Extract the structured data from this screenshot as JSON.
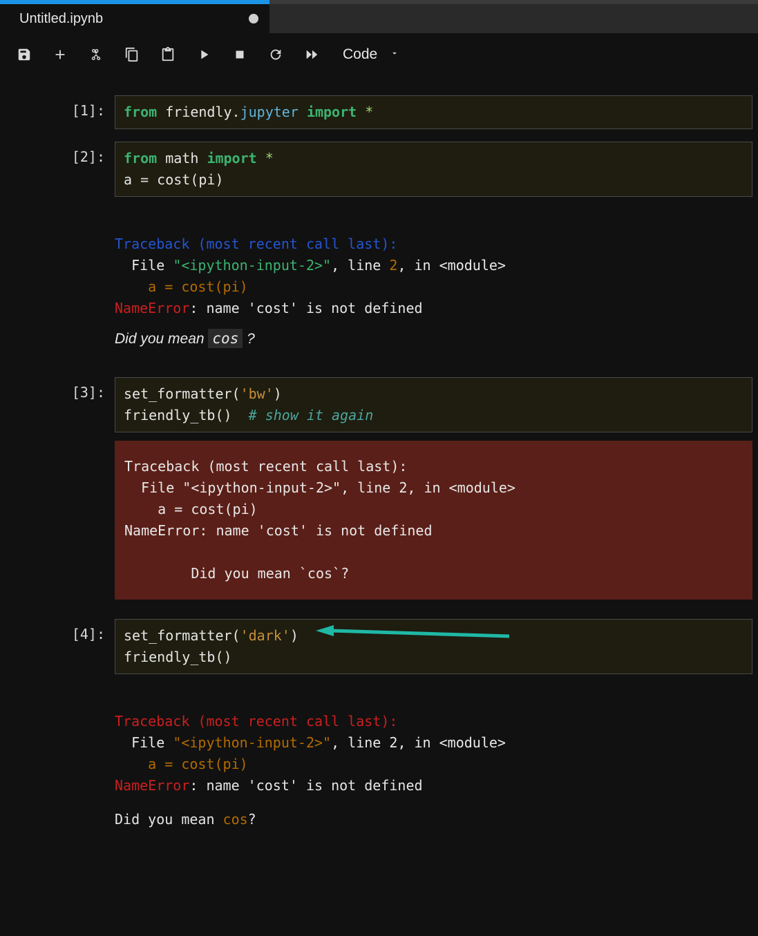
{
  "tab": {
    "title": "Untitled.ipynb"
  },
  "toolbar": {
    "celltype": "Code"
  },
  "cells": {
    "c1": {
      "prompt": "[1]:",
      "kw1": "from",
      "mod1": "friendly",
      "dot": ".",
      "mod2": "jupyter",
      "kw2": "import",
      "star": "*"
    },
    "c2": {
      "prompt": "[2]:",
      "kw1": "from",
      "mod1": "math",
      "kw2": "import",
      "star": "*",
      "line2a": "a ",
      "eq": "=",
      "line2b": " cost(pi)"
    },
    "out2": {
      "tb_head": "Traceback (most recent call last):",
      "file_lbl": "  File ",
      "fname": "\"<ipython-input-2>\"",
      "linecomma": ", line ",
      "lineno": "2",
      "inmod": ", in <module>",
      "codeline": "    a = cost(pi)",
      "err": "NameError",
      "errmsg": ": name 'cost' is not defined",
      "didyou_pre": "Did you mean ",
      "didyou_sugg": "cos",
      "didyou_post": " ?"
    },
    "c3": {
      "prompt": "[3]:",
      "l1a": "set_formatter(",
      "l1s": "'bw'",
      "l1b": ")",
      "l2a": "friendly_tb()  ",
      "l2c": "# show it again"
    },
    "out3": {
      "tb_head": "Traceback (most recent call last):",
      "file_line": "  File \"<ipython-input-2>\", line 2, in <module>",
      "codeline": "    a = cost(pi)",
      "errline": "NameError: name 'cost' is not defined",
      "blank": "",
      "didyou": "        Did you mean `cos`?"
    },
    "c4": {
      "prompt": "[4]:",
      "l1a": "set_formatter(",
      "l1s": "'dark'",
      "l1b": ")",
      "l2": "friendly_tb()"
    },
    "out4": {
      "tb_head": "Traceback (most recent call last):",
      "file_lbl": "  File ",
      "fname": "\"<ipython-input-2>\"",
      "linecomma": ", line ",
      "lineno": "2",
      "inmod": ", in <module>",
      "codeline": "    a = cost(pi)",
      "err": "NameError",
      "errmsg": ": name 'cost' is not defined",
      "didyou_pre": "Did you mean ",
      "didyou_sugg": "cos",
      "didyou_post": "?"
    }
  }
}
